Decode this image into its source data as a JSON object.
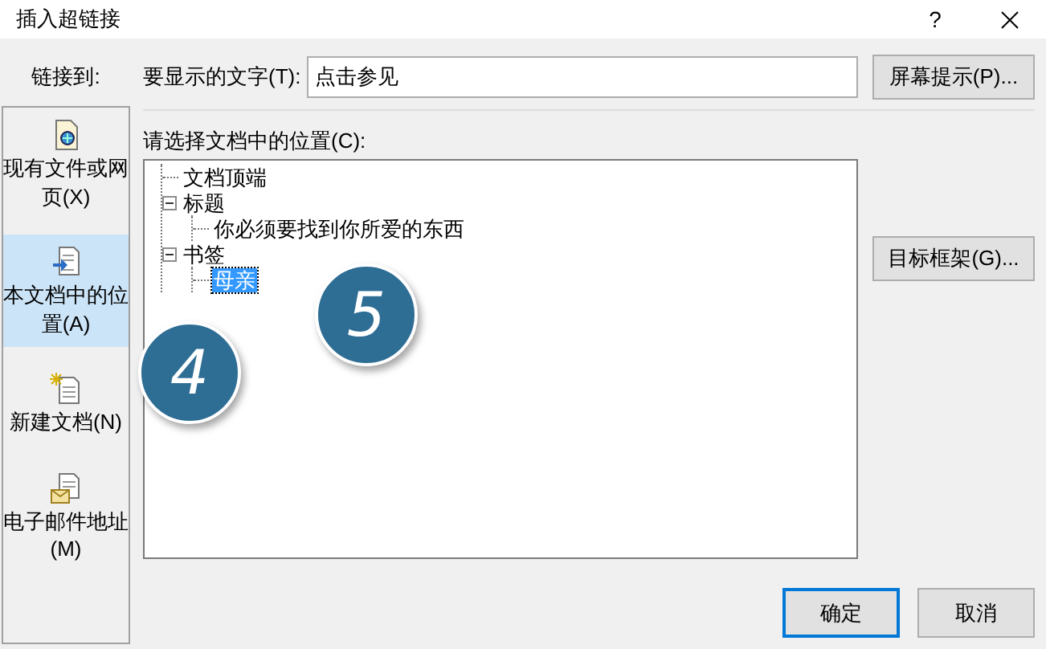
{
  "window": {
    "title": "插入超链接",
    "help_button": "?"
  },
  "link_to": {
    "label": "链接到:",
    "items": [
      {
        "label": "现有文件或网页(X)",
        "selected": false
      },
      {
        "label": "本文档中的位置(A)",
        "selected": true
      },
      {
        "label": "新建文档(N)",
        "selected": false
      },
      {
        "label": "电子邮件地址(M)",
        "selected": false
      }
    ]
  },
  "display_text": {
    "label": "要显示的文字(T):",
    "value": "点击参见"
  },
  "screen_tip_button": "屏幕提示(P)...",
  "location": {
    "label": "请选择文档中的位置(C):",
    "tree": [
      {
        "label": "文档顶端",
        "selected": false
      },
      {
        "label": "标题",
        "expanded": true,
        "selected": false,
        "children": [
          {
            "label": "你必须要找到你所爱的东西",
            "selected": false
          }
        ]
      },
      {
        "label": "书签",
        "expanded": true,
        "selected": false,
        "children": [
          {
            "label": "母亲",
            "selected": true
          }
        ]
      }
    ]
  },
  "target_frame_button": "目标框架(G)...",
  "buttons": [
    {
      "label": "确定",
      "default": true
    },
    {
      "label": "取消",
      "default": false
    }
  ],
  "step_badges": [
    "4",
    "5"
  ]
}
